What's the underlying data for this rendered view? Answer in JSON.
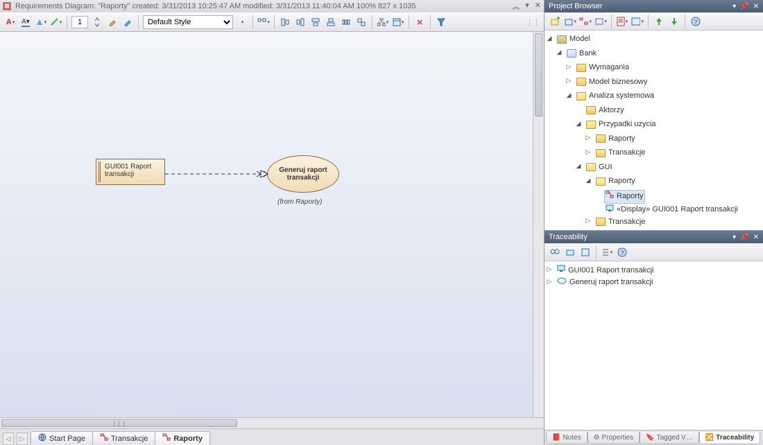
{
  "titlebar": {
    "text": "Requirements Diagram: \"Raporty\"   created: 3/31/2013 10:25:47 AM   modified: 3/31/2013 11:40:04 AM   100%   827 x 1035"
  },
  "toolbar": {
    "zoom": "1",
    "style": "Default Style"
  },
  "diagram": {
    "node1": "GUI001 Raport transakcji",
    "node2_line1": "Generuj raport",
    "node2_line2": "transakcji",
    "from": "(from Raporty)"
  },
  "tabs": {
    "start": "Start Page",
    "transakcje": "Transakcje",
    "raporty": "Raporty"
  },
  "projectBrowser": {
    "title": "Project Browser",
    "model": "Model",
    "bank": "Bank",
    "wymagania": "Wymagania",
    "modelBiznesowy": "Model biznesowy",
    "analiza": "Analiza systemowa",
    "aktorzy": "Aktorzy",
    "przypadki": "Przypadki uzycia",
    "raporty": "Raporty",
    "transakcje": "Transakcje",
    "gui": "GUI",
    "guiRaporty": "Raporty",
    "diagRaporty": "Raporty",
    "displayItem": "«Display» GUI001 Raport transakcji",
    "guiTransakcje": "Transakcje"
  },
  "traceability": {
    "title": "Traceability",
    "item1": "GUI001 Raport transakcji",
    "item2": "Generuj raport transakcji"
  },
  "bottomTabs": {
    "notes": "Notes",
    "properties": "Properties",
    "tagged": "Tagged V…",
    "trace": "Traceability"
  }
}
